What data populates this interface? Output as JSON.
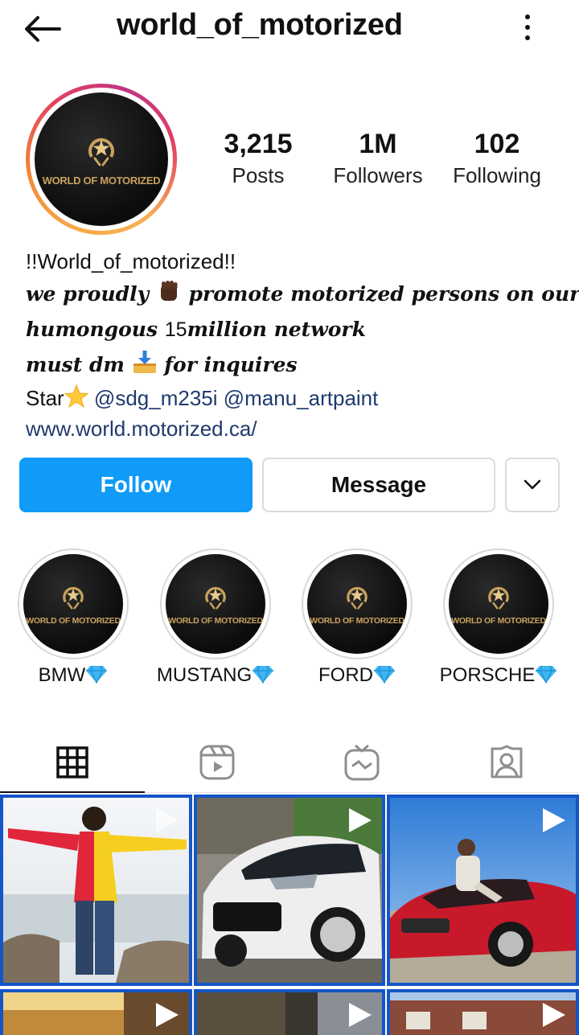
{
  "header": {
    "username": "world_of_motorized",
    "back_icon": "arrow-left-icon",
    "more_icon": "more-vertical-icon"
  },
  "profile": {
    "avatar_logo_text": "WORLD OF MOTORIZED",
    "stats": [
      {
        "value": "3,215",
        "label": "Posts"
      },
      {
        "value": "1M",
        "label": "Followers"
      },
      {
        "value": "102",
        "label": "Following"
      }
    ]
  },
  "bio": {
    "name": "!!World_of_motorized!!",
    "line1_a": "we proudly ",
    "line1_b": " promote motorized persons on our",
    "line2_a": "humongous ",
    "line2_b": "15",
    "line2_c": "million network",
    "line3_a": "must dm ",
    "line3_b": " for inquires",
    "line4_prefix": "Star",
    "mention1": "@sdg_m235i",
    "mention2": "@manu_artpaint",
    "website": "www.world.motorized.ca/"
  },
  "actions": {
    "follow": "Follow",
    "message": "Message",
    "dropdown_icon": "chevron-down-icon"
  },
  "highlights": [
    {
      "label": "BMW",
      "logo_text": "WORLD OF MOTORIZED"
    },
    {
      "label": "MUSTANG",
      "logo_text": "WORLD OF MOTORIZED"
    },
    {
      "label": "FORD",
      "logo_text": "WORLD OF MOTORIZED"
    },
    {
      "label": "PORSCHE",
      "logo_text": "WORLD OF MOTORIZED"
    }
  ],
  "tabs": [
    {
      "icon": "grid-icon",
      "active": true
    },
    {
      "icon": "reels-icon",
      "active": false
    },
    {
      "icon": "igtv-icon",
      "active": false
    },
    {
      "icon": "tagged-icon",
      "active": false
    }
  ],
  "colors": {
    "follow_button": "#0f9bf7",
    "link": "#1e3a6e",
    "grid_border": "#1555c7",
    "logo_gold": "#c9a25d"
  }
}
